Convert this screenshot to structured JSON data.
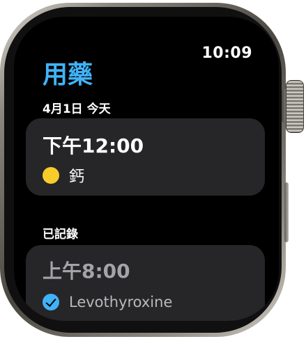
{
  "status_bar": {
    "time": "10:09"
  },
  "app": {
    "title": "用藥"
  },
  "today": {
    "date_label": "4月1日 今天",
    "schedule": {
      "time": "下午12:00",
      "medication": {
        "name": "鈣",
        "icon": "yellow-pill-icon",
        "color": "#f8cc2a"
      }
    }
  },
  "logged": {
    "header": "已記錄",
    "entry": {
      "time": "上午8:00",
      "medication": {
        "name": "Levothyroxine",
        "icon": "checkmark-icon",
        "color": "#41b2f7"
      }
    }
  },
  "colors": {
    "accent": "#41b2f7",
    "card": "#262628",
    "screen": "#000000"
  }
}
